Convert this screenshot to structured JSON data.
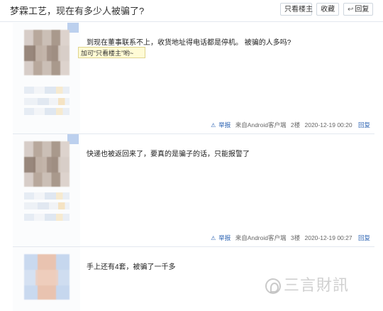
{
  "header": {
    "title": "梦霖工艺，现在有多少人被骗了?",
    "only_op_label": "只看楼主",
    "collect_label": "收藏",
    "reply_label": "回复"
  },
  "tooltip": {
    "text": "加可“只看楼主”哟~"
  },
  "posts": [
    {
      "content": "到现在董事联系不上，收货地址得电话都是停机。 被骗的人多吗?",
      "report": "举报",
      "source": "来自Android客户端",
      "floor": "2楼",
      "time": "2020-12-19 00:20",
      "reply": "回复"
    },
    {
      "content": "快递也被返回来了，要真的是骗子的话，只能报警了",
      "report": "举报",
      "source": "来自Android客户端",
      "floor": "3楼",
      "time": "2020-12-19 00:27",
      "reply": "回复"
    },
    {
      "content": "手上还有4套，被骗了一千多"
    }
  ],
  "watermark": {
    "text": "三言財訊"
  },
  "colors": {
    "link": "#2d64b3",
    "border": "#e3e8ef",
    "tooltip_bg": "#fffbd6"
  },
  "icons": {
    "warning": "warning-icon",
    "reply_arrow": "reply-arrow-icon"
  }
}
